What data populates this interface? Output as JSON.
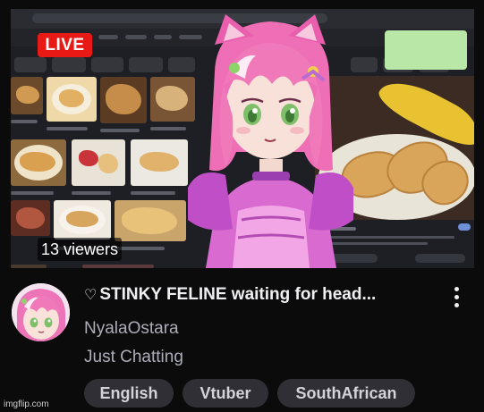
{
  "stream": {
    "live_label": "LIVE",
    "viewers_text": "13 viewers",
    "title_icon": "heart-outline-icon",
    "title": "STINKY FELINE waiting for head...",
    "channel_name": "NyalaOstara",
    "category": "Just Chatting",
    "tags": [
      "English",
      "Vtuber",
      "SouthAfrican"
    ]
  },
  "colors": {
    "live": "#e91916",
    "background": "#0b0b0c",
    "tag_bg": "#2f2f35",
    "secondary_text": "#adadb8"
  },
  "watermark": "imgflip.com"
}
